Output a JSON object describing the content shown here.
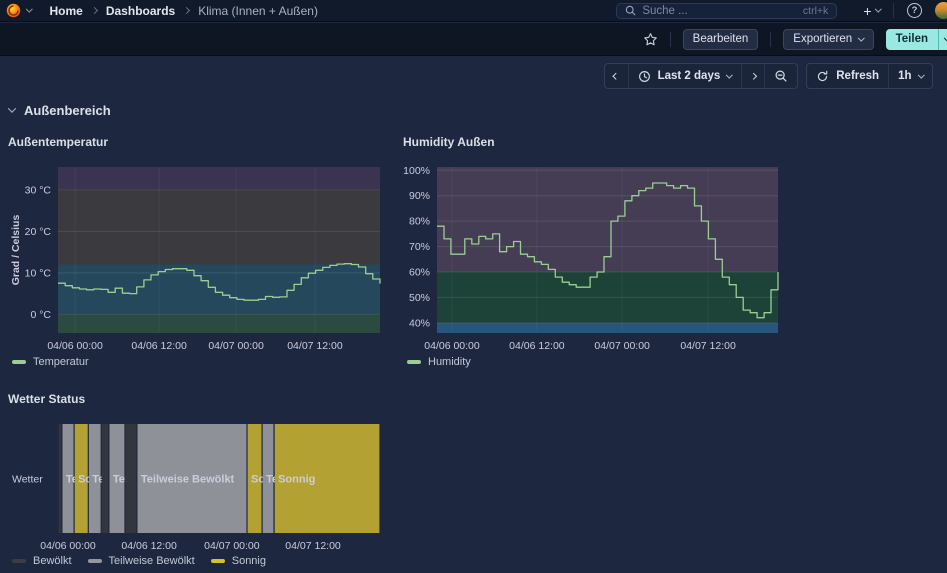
{
  "topnav": {
    "breadcrumbs": [
      "Home",
      "Dashboards",
      "Klima (Innen + Außen)"
    ],
    "search_placeholder": "Suche ...",
    "search_shortcut": "ctrl+k",
    "plus_label": "+",
    "help_label": "?"
  },
  "toolbar": {
    "edit_label": "Bearbeiten",
    "export_label": "Exportieren",
    "share_label": "Teilen"
  },
  "timebar": {
    "range_label": "Last 2 days",
    "refresh_label": "Refresh",
    "interval_label": "1h"
  },
  "row": {
    "title": "Außenbereich"
  },
  "colors": {
    "series_green": "#9bce93",
    "share_accent": "#9ae8e2",
    "background": "#1d2740"
  },
  "chart_data": [
    {
      "id": "temperature",
      "type": "line",
      "title": "Außentemperatur",
      "ylabel": "Grad / Celsius",
      "legend": "Temperatur",
      "color": "#9bce93",
      "ylim": [
        -4.5,
        35.5
      ],
      "yticks": [
        {
          "v": 0,
          "label": "0 °C"
        },
        {
          "v": 10,
          "label": "10 °C"
        },
        {
          "v": 20,
          "label": "20 °C"
        },
        {
          "v": 30,
          "label": "30 °C"
        }
      ],
      "xticks": [
        {
          "f": 0.053,
          "label": "04/06 00:00"
        },
        {
          "f": 0.314,
          "label": "04/06 12:00"
        },
        {
          "f": 0.553,
          "label": "04/07 00:00"
        },
        {
          "f": 0.798,
          "label": "04/07 12:00"
        }
      ],
      "bands": [
        {
          "from": 30,
          "to": 36,
          "color": "#3b3450"
        },
        {
          "from": 12,
          "to": 30,
          "color": "#3a3a3f"
        },
        {
          "from": 0,
          "to": 12,
          "color": "#26485c"
        },
        {
          "from": -5,
          "to": 0,
          "color": "#2b4a40"
        }
      ],
      "values": [
        7.5,
        6.9,
        6.4,
        6.1,
        5.9,
        6.1,
        6.0,
        5.3,
        6.3,
        5.1,
        5.0,
        6.6,
        8.3,
        9.5,
        10.3,
        10.8,
        11.0,
        11.0,
        10.6,
        9.3,
        8.1,
        6.5,
        5.3,
        4.6,
        4.0,
        3.6,
        3.4,
        3.4,
        3.6,
        4.3,
        4.1,
        4.2,
        5.8,
        7.2,
        8.8,
        9.9,
        10.6,
        11.3,
        11.8,
        12.1,
        12.2,
        12.0,
        11.4,
        9.8,
        8.5,
        7.4
      ]
    },
    {
      "id": "humidity",
      "type": "line",
      "title": "Humidity Außen",
      "ylabel": "",
      "legend": "Humidity",
      "color": "#9bce93",
      "ylim": [
        36,
        101.3
      ],
      "yticks": [
        {
          "v": 40,
          "label": "40%"
        },
        {
          "v": 50,
          "label": "50%"
        },
        {
          "v": 60,
          "label": "60%"
        },
        {
          "v": 70,
          "label": "70%"
        },
        {
          "v": 80,
          "label": "80%"
        },
        {
          "v": 90,
          "label": "90%"
        },
        {
          "v": 100,
          "label": "100%"
        }
      ],
      "xticks": [
        {
          "f": 0.044,
          "label": "04/06 00:00"
        },
        {
          "f": 0.293,
          "label": "04/06 12:00"
        },
        {
          "f": 0.543,
          "label": "04/07 00:00"
        },
        {
          "f": 0.795,
          "label": "04/07 12:00"
        }
      ],
      "bands": [
        {
          "from": 60,
          "to": 102,
          "color": "#453d54"
        },
        {
          "from": 40,
          "to": 60,
          "color": "#1d4238"
        },
        {
          "from": 35,
          "to": 40,
          "color": "#26567b"
        }
      ],
      "values": [
        78,
        73,
        67,
        67,
        73,
        71,
        74,
        73,
        75,
        68,
        70,
        72,
        67,
        66,
        64,
        63,
        61,
        58,
        56,
        55,
        54,
        54,
        58,
        60,
        66,
        80,
        82,
        88,
        90,
        92,
        93,
        95,
        95,
        94,
        93,
        94,
        93,
        86,
        80,
        73,
        65,
        58,
        55,
        50,
        45,
        44,
        42,
        44,
        53,
        60
      ]
    },
    {
      "id": "weather",
      "type": "state-timeline",
      "title": "Wetter Status",
      "row_label": "Wetter",
      "xticks": [
        {
          "f": 0.031,
          "label": "04/06 00:00"
        },
        {
          "f": 0.283,
          "label": "04/06 12:00"
        },
        {
          "f": 0.54,
          "label": "04/07 00:00"
        },
        {
          "f": 0.792,
          "label": "04/07 12:00"
        }
      ],
      "states": {
        "bewoelkt": {
          "label": "Bewölkt",
          "color": "#33363c",
          "legend_color": "#3a3d42"
        },
        "teilweise": {
          "label": "Teilweise Bewölkt",
          "color": "#8e9298",
          "legend_color": "#94989e"
        },
        "sonnig": {
          "label": "Sonnig",
          "color": "#b3a233",
          "legend_color": "#d3c228"
        }
      },
      "label_colors": {
        "light": "#eceef2",
        "dark": "#55502e"
      },
      "segments": [
        {
          "state": "bewoelkt",
          "f0": 0.0,
          "f1": 0.012,
          "label": ""
        },
        {
          "state": "teilweise",
          "f0": 0.012,
          "f1": 0.05,
          "label": "Te"
        },
        {
          "state": "sonnig",
          "f0": 0.05,
          "f1": 0.094,
          "label": "So"
        },
        {
          "state": "teilweise",
          "f0": 0.094,
          "f1": 0.134,
          "label": "Te"
        },
        {
          "state": "bewoelkt",
          "f0": 0.134,
          "f1": 0.158,
          "label": ""
        },
        {
          "state": "teilweise",
          "f0": 0.158,
          "f1": 0.208,
          "label": "Tei"
        },
        {
          "state": "bewoelkt",
          "f0": 0.208,
          "f1": 0.245,
          "label": ""
        },
        {
          "state": "teilweise",
          "f0": 0.245,
          "f1": 0.587,
          "label": "Teilweise Bewölkt"
        },
        {
          "state": "sonnig",
          "f0": 0.587,
          "f1": 0.634,
          "label": "So"
        },
        {
          "state": "teilweise",
          "f0": 0.634,
          "f1": 0.671,
          "label": "Te"
        },
        {
          "state": "sonnig",
          "f0": 0.671,
          "f1": 1.0,
          "label": "Sonnig"
        }
      ]
    }
  ]
}
